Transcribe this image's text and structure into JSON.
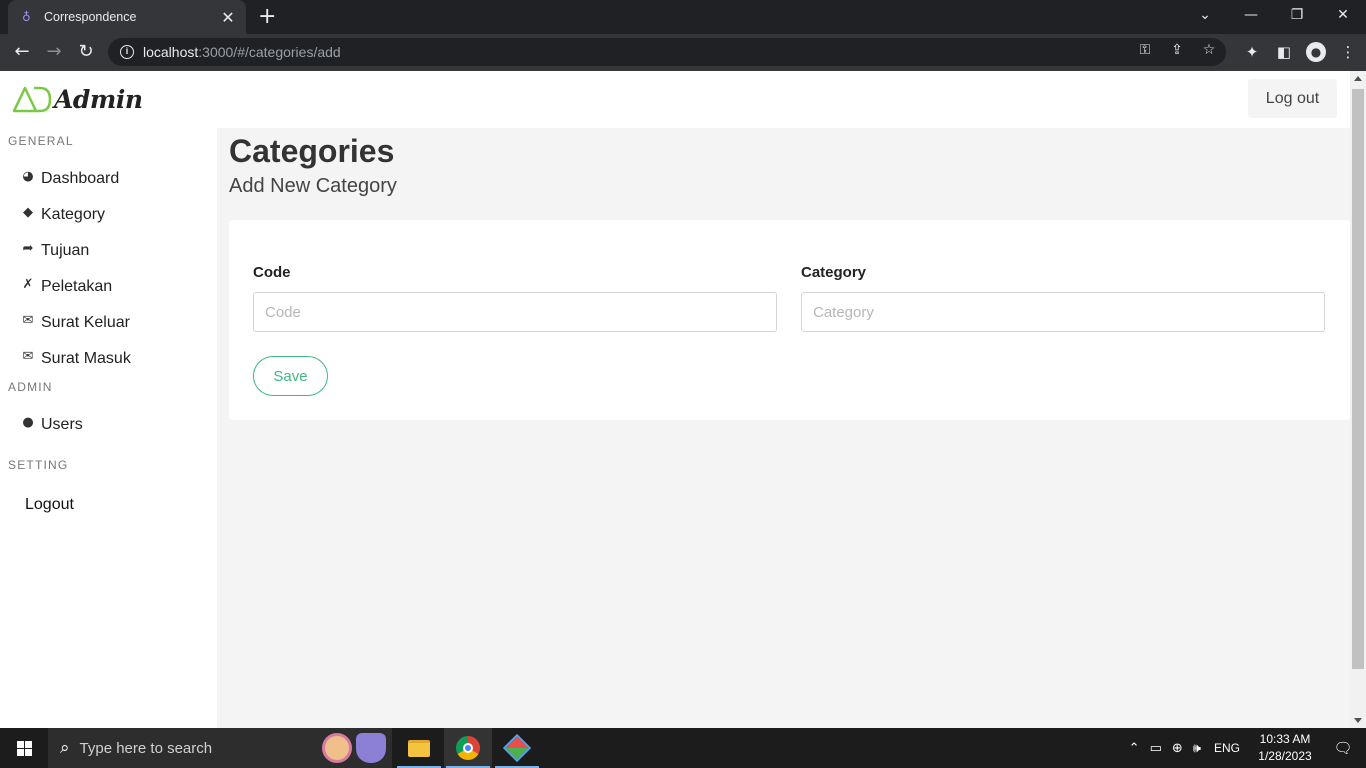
{
  "browser": {
    "tab_title": "Correspondence",
    "tab_close": "✕",
    "new_tab": "+",
    "url_host": "localhost",
    "url_rest": ":3000/#/categories/add",
    "window_controls": {
      "dropdown": "⌄",
      "minimize": "—",
      "restore": "❐",
      "close": "✕"
    },
    "nav": {
      "back": "←",
      "forward": "→",
      "reload": "↻"
    },
    "omnibox_icons": [
      "key-icon",
      "share-icon",
      "star-icon"
    ],
    "toolbar_icons": [
      "extensions-icon",
      "sidepanel-icon",
      "profile-icon",
      "menu-icon"
    ]
  },
  "app": {
    "logo_mark": "AD",
    "logo_text": "Admin",
    "logout_top": "Log out",
    "accent_color": "#41b883",
    "logo_color": "#7ac943"
  },
  "sidebar": {
    "general_label": "GENERAL",
    "admin_label": "ADMIN",
    "setting_label": "SETTING",
    "items": [
      {
        "label": "Dashboard",
        "icon": "gauge-icon",
        "glyph": "◕"
      },
      {
        "label": "Kategory",
        "icon": "tag-icon",
        "glyph": "◆"
      },
      {
        "label": "Tujuan",
        "icon": "share-arrow-icon",
        "glyph": "➦"
      },
      {
        "label": "Peletakan",
        "icon": "xing-icon",
        "glyph": "✗"
      },
      {
        "label": "Surat Keluar",
        "icon": "envelope-icon",
        "glyph": "✉"
      },
      {
        "label": "Surat Masuk",
        "icon": "envelope-open-icon",
        "glyph": "✉"
      }
    ],
    "admin_items": [
      {
        "label": "Users",
        "icon": "user-icon",
        "glyph": "●"
      }
    ],
    "logout": "Logout"
  },
  "main": {
    "title": "Categories",
    "subtitle": "Add New Category",
    "form": {
      "code_label": "Code",
      "code_placeholder": "Code",
      "code_value": "",
      "category_label": "Category",
      "category_placeholder": "Category",
      "category_value": "",
      "save_label": "Save"
    }
  },
  "taskbar": {
    "search_placeholder": "Type here to search",
    "apps": [
      "file-explorer-icon",
      "chrome-icon",
      "git-icon"
    ],
    "lang": "ENG",
    "time": "10:33 AM",
    "date": "1/28/2023"
  }
}
